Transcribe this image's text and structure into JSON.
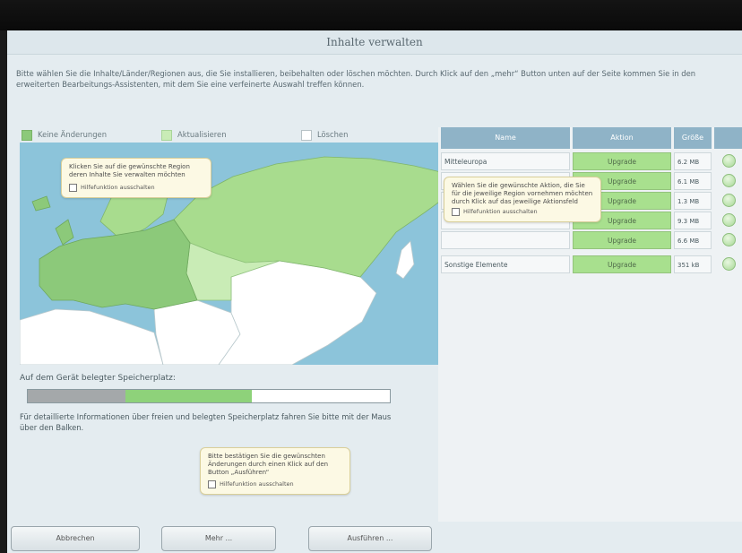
{
  "title": "Inhalte verwalten",
  "intro": "Bitte wählen Sie die Inhalte/Länder/Regionen aus, die Sie installieren, beibehalten oder löschen möchten. Durch Klick auf den „mehr“ Button unten auf der Seite kommen Sie in den erweiterten Bearbeitungs-Assistenten, mit dem Sie eine verfeinerte Auswahl treffen können.",
  "legend": [
    {
      "label": "Keine Änderungen",
      "color": "#8cc97a"
    },
    {
      "label": "Aktualisieren",
      "color": "#c9ecb6"
    },
    {
      "label": "Löschen",
      "color": "#ffffff"
    }
  ],
  "map_tip": {
    "text": "Klicken Sie auf die gewünschte Region deren Inhalte Sie verwalten möchten",
    "checkbox_label": "Hilfefunktion ausschalten"
  },
  "table": {
    "columns": [
      "Name",
      "Aktion",
      "Größe"
    ],
    "rows": [
      {
        "name": "Mitteleuropa",
        "action": "Upgrade",
        "size": "6.2 MB"
      },
      {
        "name": "",
        "action": "Upgrade",
        "size": "6.1 MB"
      },
      {
        "name": "",
        "action": "Upgrade",
        "size": "1.3 MB"
      },
      {
        "name": "",
        "action": "Upgrade",
        "size": "9.3 MB"
      },
      {
        "name": "",
        "action": "Upgrade",
        "size": "6.6 MB"
      },
      {
        "name": "Sonstige Elemente",
        "action": "Upgrade",
        "size": "351 kB"
      }
    ],
    "tip": {
      "text": "Wählen Sie die gewünschte Aktion, die Sie für die jeweilige Region vornehmen möchten durch Klick auf das jeweilige Aktionsfeld",
      "checkbox_label": "Hilfefunktion ausschalten"
    }
  },
  "storage": {
    "label": "Auf dem Gerät belegter Speicherplatz:",
    "used_fraction": 0.27,
    "pending_fraction": 0.62,
    "info": "Für detaillierte Informationen über freien und belegten Speicherplatz fahren Sie bitte mit der Maus über den Balken."
  },
  "confirm_tip": {
    "text": "Bitte bestätigen Sie die gewünschten Änderungen durch einen Klick auf den Button „Ausführen“",
    "checkbox_label": "Hilfefunktion ausschalten"
  },
  "buttons": {
    "cancel": "Abbrechen",
    "more": "Mehr ...",
    "execute": "Ausführen ..."
  }
}
